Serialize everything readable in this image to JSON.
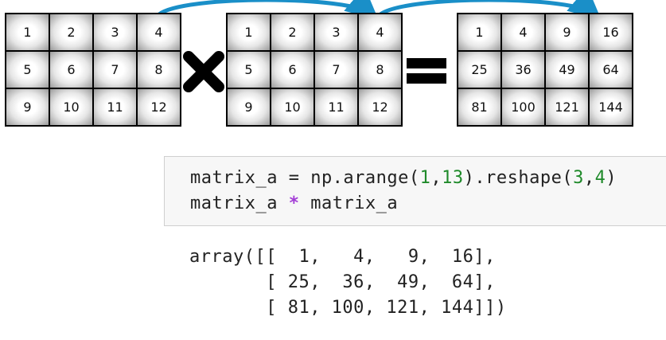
{
  "matrix_a": [
    [
      1,
      2,
      3,
      4
    ],
    [
      5,
      6,
      7,
      8
    ],
    [
      9,
      10,
      11,
      12
    ]
  ],
  "matrix_b": [
    [
      1,
      2,
      3,
      4
    ],
    [
      5,
      6,
      7,
      8
    ],
    [
      9,
      10,
      11,
      12
    ]
  ],
  "matrix_result": [
    [
      1,
      4,
      9,
      16
    ],
    [
      25,
      36,
      49,
      64
    ],
    [
      81,
      100,
      121,
      144
    ]
  ],
  "colors": {
    "arrow": "#1a8fc8",
    "code_number": "#1f8a2a",
    "code_operator": "#a33dd6",
    "code_bg": "#f7f7f7"
  },
  "icons": {
    "multiply": "multiply-sign-icon",
    "equals": "equals-sign-icon"
  },
  "code": {
    "line1": {
      "pre": "matrix_a = np.arange(",
      "n1": "1",
      "c1": ",",
      "n2": "13",
      "mid": ").reshape(",
      "n3": "3",
      "c2": ",",
      "n4": "4",
      "post": ")"
    },
    "line2": {
      "pre": "matrix_a ",
      "op": "*",
      "post": " matrix_a"
    }
  },
  "output": {
    "line1": "array([[  1,   4,   9,  16],",
    "line2": "       [ 25,  36,  49,  64],",
    "line3": "       [ 81, 100, 121, 144]])"
  }
}
